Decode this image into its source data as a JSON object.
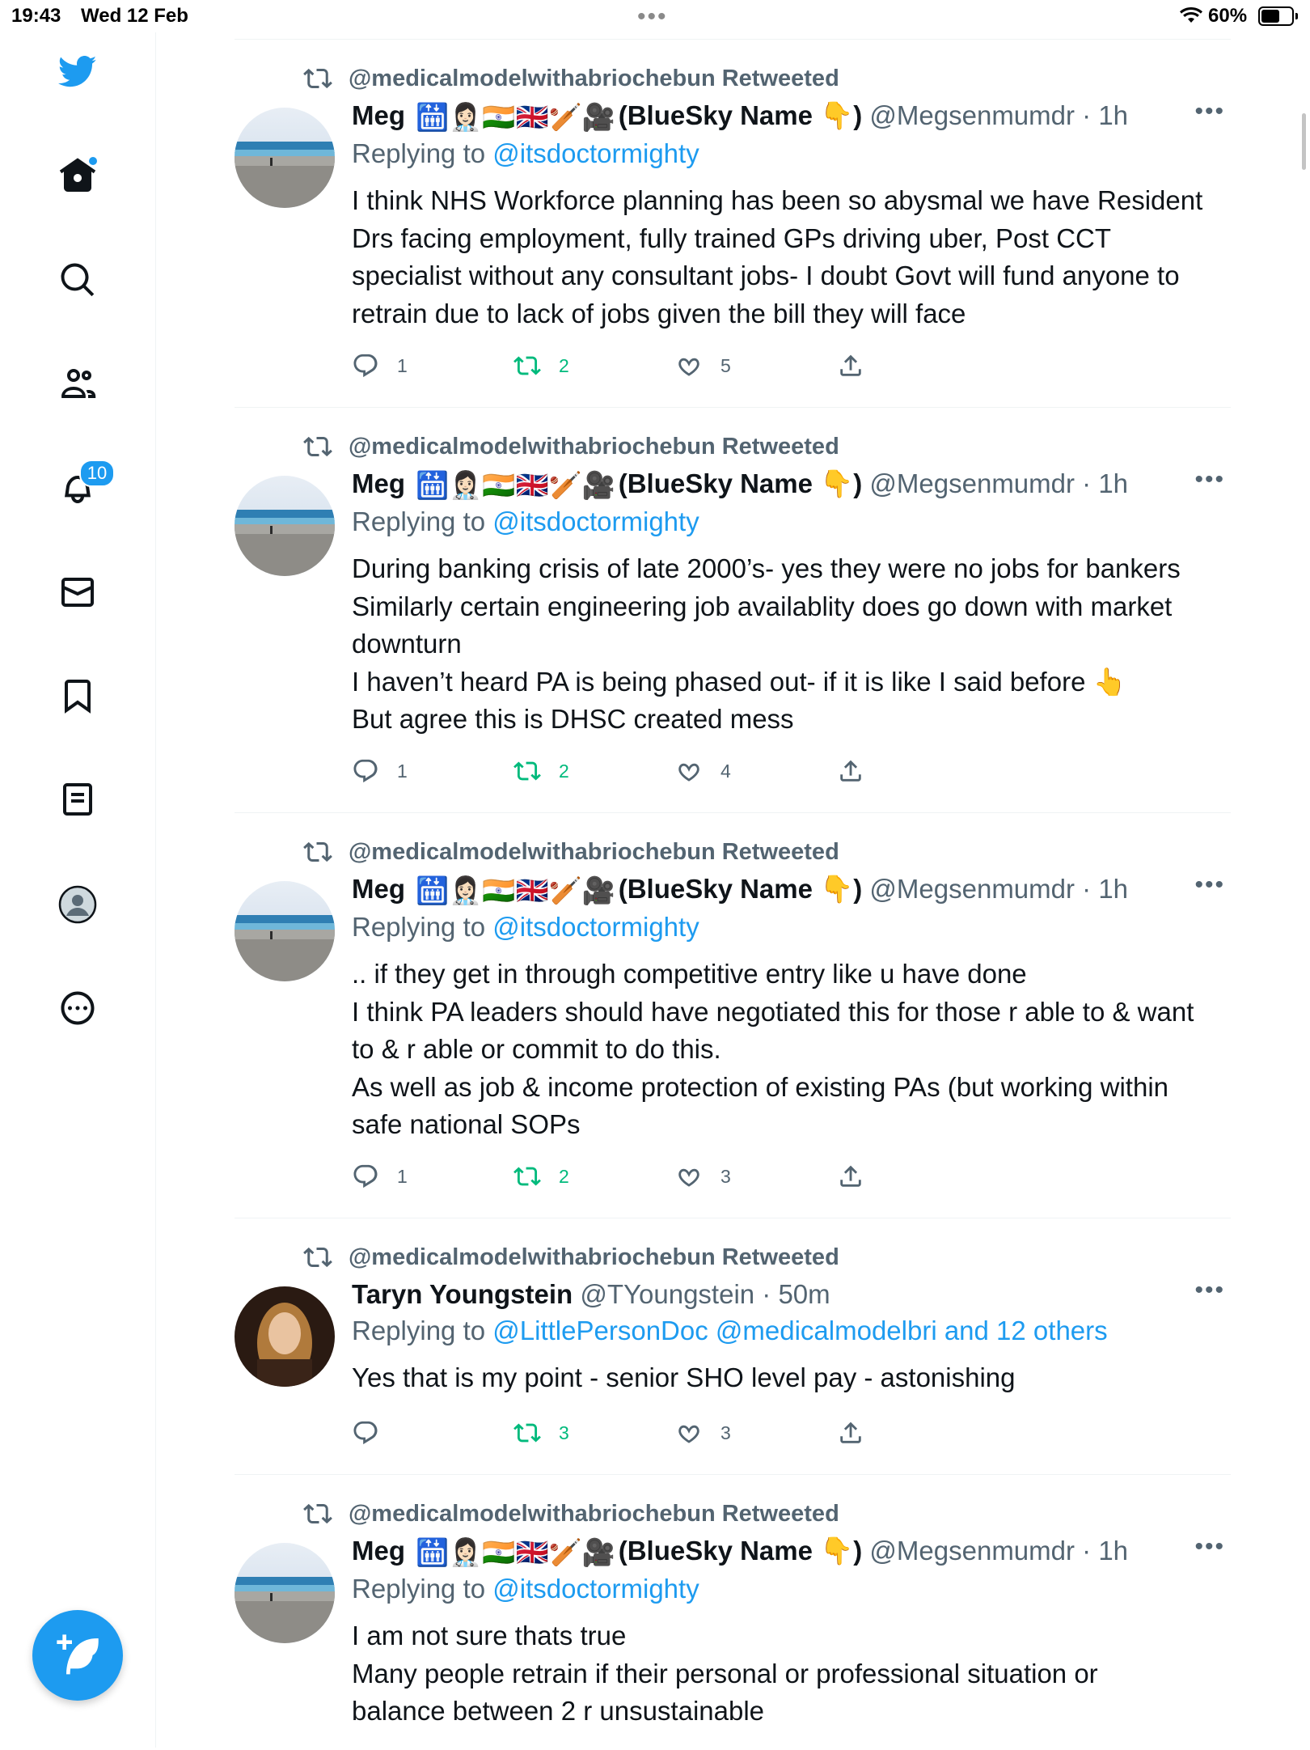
{
  "status_bar": {
    "time": "19:43",
    "date": "Wed 12 Feb",
    "battery": "60%",
    "battery_level": 0.6
  },
  "sidebar": {
    "notifications_badge": "10",
    "items": [
      "twitter-logo",
      "home-icon",
      "search-icon",
      "communities-icon",
      "notifications-icon",
      "messages-icon",
      "bookmarks-icon",
      "lists-icon",
      "profile-icon",
      "more-icon"
    ],
    "compose_icon": "compose-icon"
  },
  "colors": {
    "accent": "#1d9bf0",
    "retweet": "#00ba7c",
    "muted": "#536471",
    "text": "#0f1419"
  },
  "tweets": [
    {
      "retweeted_by": "@medicalmodelwithabriochebun Retweeted",
      "name": "Meg",
      "name_suffix": "(BlueSky Name",
      "name_close": ")",
      "handle_time": "@Megsenmumdr · 1h",
      "replying_prefix": "Replying to",
      "replying_to": "@itsdoctormighty",
      "lines": [
        "I think NHS Workforce planning has been so abysmal we have Resident",
        "Drs facing employment, fully trained GPs driving uber, Post CCT",
        "specialist without any consultant jobs- I doubt Govt will fund anyone to",
        "retrain due to lack of jobs given the bill they will face"
      ],
      "replies": "1",
      "retweets": "2",
      "likes": "5"
    },
    {
      "retweeted_by": "@medicalmodelwithabriochebun Retweeted",
      "name": "Meg",
      "name_suffix": "(BlueSky Name",
      "name_close": ")",
      "handle_time": "@Megsenmumdr · 1h",
      "replying_prefix": "Replying to",
      "replying_to": "@itsdoctormighty",
      "lines": [
        "During banking crisis of late 2000’s- yes they were no jobs for bankers",
        "Similarly certain engineering job availablity does go down with market",
        "downturn",
        "I haven’t heard PA is being phased out- if it is like I said before 👆",
        "But agree this is DHSC created mess"
      ],
      "replies": "1",
      "retweets": "2",
      "likes": "4"
    },
    {
      "retweeted_by": "@medicalmodelwithabriochebun Retweeted",
      "name": "Meg",
      "name_suffix": "(BlueSky Name",
      "name_close": ")",
      "handle_time": "@Megsenmumdr · 1h",
      "replying_prefix": "Replying to",
      "replying_to": "@itsdoctormighty",
      "lines": [
        ".. if they get in through competitive entry like u have done",
        "I think PA leaders should have negotiated this for those r able to & want",
        "to & r able or commit to do this.",
        "As well as job & income protection of existing PAs (but working within",
        "safe national SOPs"
      ],
      "replies": "1",
      "retweets": "2",
      "likes": "3"
    },
    {
      "retweeted_by": "@medicalmodelwithabriochebun Retweeted",
      "name": "Taryn Youngstein",
      "name_suffix": "",
      "name_close": "",
      "handle_time": "@TYoungstein · 50m",
      "replying_prefix": "Replying to",
      "replying_to": "@LittlePersonDoc @medicalmodelbri and 12 others",
      "lines": [
        "Yes that is my point - senior SHO level pay - astonishing"
      ],
      "replies": "",
      "retweets": "3",
      "likes": "3"
    },
    {
      "retweeted_by": "@medicalmodelwithabriochebun Retweeted",
      "name": "Meg",
      "name_suffix": "(BlueSky Name",
      "name_close": ")",
      "handle_time": "@Megsenmumdr · 1h",
      "replying_prefix": "Replying to",
      "replying_to": "@itsdoctormighty",
      "lines": [
        "I am not sure thats true",
        "Many people retrain if their personal or professional situation or",
        "balance between 2 r unsustainable"
      ],
      "replies": "",
      "retweets": "",
      "likes": ""
    }
  ]
}
